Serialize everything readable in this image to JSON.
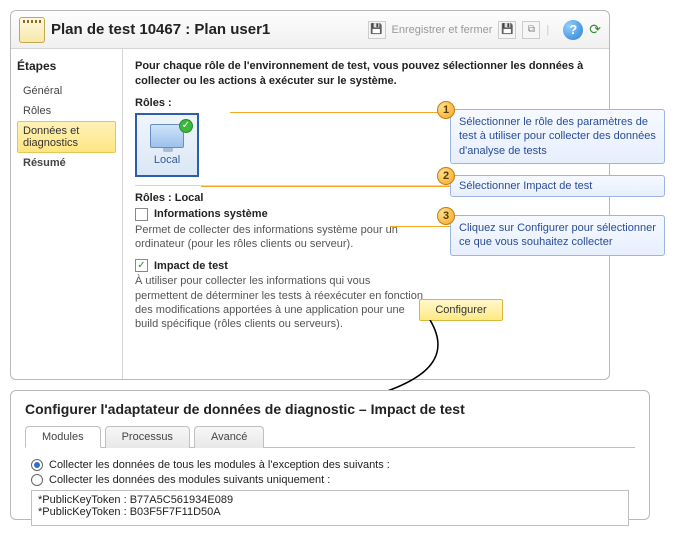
{
  "titlebar": {
    "title": "Plan de test 10467 : Plan user1",
    "save_close": "Enregistrer et fermer"
  },
  "sidebar": {
    "heading": "Étapes",
    "items": [
      {
        "label": "Général"
      },
      {
        "label": "Rôles"
      },
      {
        "label": "Données et diagnostics"
      },
      {
        "label": "Résumé"
      }
    ]
  },
  "content": {
    "instruction": "Pour chaque rôle de l'environnement de test, vous pouvez sélectionner les données à collecter ou les actions à exécuter sur le système.",
    "roles_label": "Rôles :",
    "tile_label": "Local",
    "roles_local_label": "Rôles : Local",
    "sys_info_title": "Informations système",
    "sys_info_desc": "Permet de collecter des informations système pour un ordinateur (pour les rôles clients ou serveur).",
    "impact_title": "Impact de test",
    "impact_desc": "À utiliser pour collecter les informations qui vous permettent de déterminer les tests à réexécuter en fonction des modifications apportées à une application pour une build spécifique (rôles clients ou serveurs).",
    "configure_btn": "Configurer"
  },
  "callouts": {
    "c1": "Sélectionner le rôle des paramètres de test à utiliser pour collecter des données d'analyse de tests",
    "c2": "Sélectionner Impact de test",
    "c3": "Cliquez sur Configurer pour sélectionner ce que vous souhaitez collecter"
  },
  "panel2": {
    "title": "Configurer l'adaptateur de données de diagnostic – Impact de test",
    "tabs": [
      "Modules",
      "Processus",
      "Avancé"
    ],
    "radio1": "Collecter les données de tous les modules à l'exception des suivants :",
    "radio2": "Collecter les données des modules suivants uniquement :",
    "tokens": [
      "*PublicKeyToken : B77A5C561934E089",
      "*PublicKeyToken : B03F5F7F11D50A"
    ]
  }
}
